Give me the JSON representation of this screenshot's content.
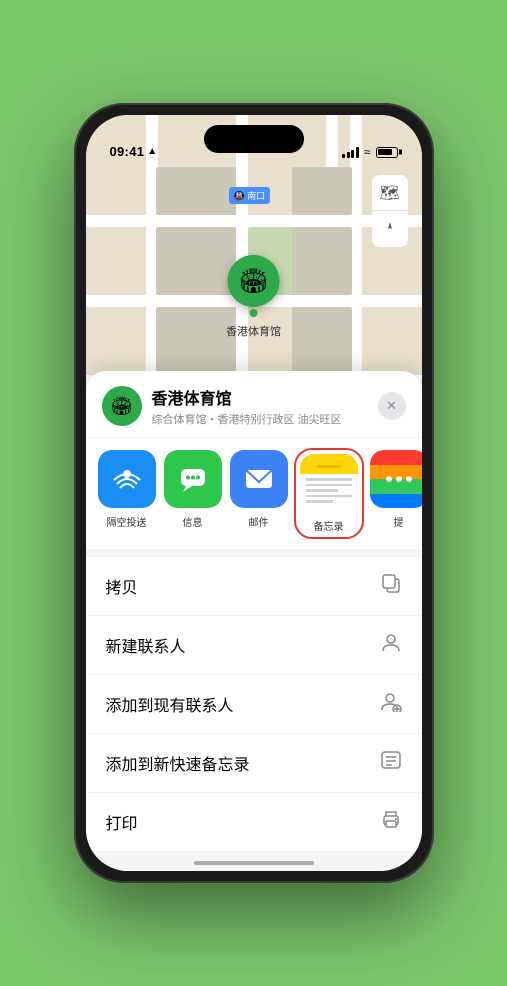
{
  "status_bar": {
    "time": "09:41",
    "location_arrow": "▲"
  },
  "map": {
    "subway_label": "🚇 南口",
    "marker_emoji": "🏟",
    "marker_label": "香港体育馆"
  },
  "map_controls": {
    "layers_icon": "🗺",
    "location_icon": "⬆"
  },
  "location_card": {
    "icon": "🏟",
    "name": "香港体育馆",
    "subtitle": "综合体育馆・香港特别行政区 油尖旺区",
    "close": "✕"
  },
  "share_apps": [
    {
      "id": "airdrop",
      "label": "隔空投送",
      "emoji": "📡"
    },
    {
      "id": "messages",
      "label": "信息",
      "emoji": "💬"
    },
    {
      "id": "mail",
      "label": "邮件",
      "emoji": "✉"
    },
    {
      "id": "notes",
      "label": "备忘录",
      "emoji": ""
    },
    {
      "id": "more",
      "label": "提",
      "emoji": "⋯"
    }
  ],
  "actions": [
    {
      "label": "拷贝",
      "icon": "📋"
    },
    {
      "label": "新建联系人",
      "icon": "👤"
    },
    {
      "label": "添加到现有联系人",
      "icon": "👥"
    },
    {
      "label": "添加到新快速备忘录",
      "icon": "📝"
    },
    {
      "label": "打印",
      "icon": "🖨"
    }
  ]
}
